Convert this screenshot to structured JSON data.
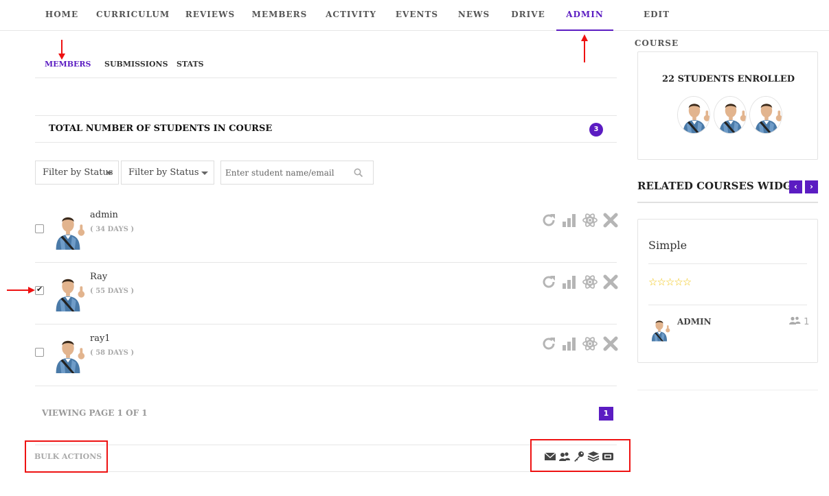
{
  "topnav": {
    "tabs": [
      {
        "label": "HOME",
        "active": true
      },
      {
        "label": "CURRICULUM",
        "active": false
      },
      {
        "label": "REVIEWS",
        "active": false
      },
      {
        "label": "MEMBERS",
        "active": false
      },
      {
        "label": "ACTIVITY",
        "active": false
      },
      {
        "label": "EVENTS",
        "active": false
      },
      {
        "label": "NEWS",
        "active": false
      },
      {
        "label": "DRIVE",
        "active": false
      },
      {
        "label": "ADMIN",
        "active": true
      },
      {
        "label": "EDIT COURSE",
        "active": false
      }
    ]
  },
  "subnav": {
    "tabs": [
      {
        "label": "MEMBERS",
        "active": true
      },
      {
        "label": "SUBMISSIONS",
        "active": false
      },
      {
        "label": "STATS",
        "active": false
      }
    ]
  },
  "students_header": {
    "title": "TOTAL NUMBER OF STUDENTS IN COURSE",
    "count": "3"
  },
  "filters": {
    "status_filter_1": "Filter by Status",
    "status_filter_2": "Filter by Status",
    "search_placeholder": "Enter student name/email"
  },
  "students": [
    {
      "name": "admin",
      "days": "( 34 DAYS )",
      "checked": false
    },
    {
      "name": "Ray",
      "days": "( 55 DAYS )",
      "checked": true
    },
    {
      "name": "ray1",
      "days": "( 58 DAYS )",
      "checked": false
    }
  ],
  "row_action_icons": [
    "reset-icon",
    "stats-icon",
    "atom-icon",
    "remove-icon"
  ],
  "pagination": {
    "viewing": "VIEWING PAGE 1 OF 1",
    "current_page": "1"
  },
  "bulk": {
    "label": "BULK ACTIONS",
    "icons": [
      "envelope-icon",
      "users-icon",
      "key-icon",
      "layers-icon",
      "ticket-icon"
    ]
  },
  "sidebar": {
    "enrolled_title": "22 STUDENTS ENROLLED",
    "related_title": "RELATED COURSES WIDGET",
    "prev_arrow": "‹",
    "next_arrow": "›",
    "course": {
      "title": "Simple",
      "stars": "☆☆☆☆☆",
      "rating": 0,
      "instructor": "ADMIN",
      "students": "1"
    }
  },
  "colors": {
    "accent": "#5b1cc2",
    "annotation": "#ee1111",
    "star": "#f1c40f"
  }
}
